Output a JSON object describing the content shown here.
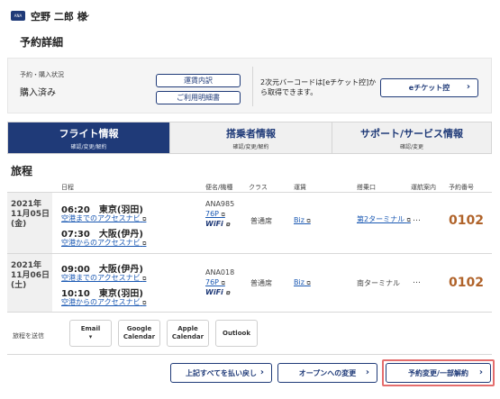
{
  "header": {
    "badge": "ANA",
    "user_name": "空野 二郎 様",
    "chevron": "⌄"
  },
  "page_title": "予約詳細",
  "status": {
    "label": "予約・購入状況",
    "value": "購入済み",
    "receipt_button": "運賃内訳",
    "statement_button": "ご利用明細書",
    "barcode_text": "2次元バーコードは[eチケット控]から取得できます。",
    "eticket_button": "eチケット控",
    "eticket_arrow": "›"
  },
  "tabs": [
    {
      "title": "フライト情報",
      "sub": "確認/変更/解約"
    },
    {
      "title": "搭乗者情報",
      "sub": "確認/変更/解約"
    },
    {
      "title": "サポート/サービス情報",
      "sub": "確認/変更"
    }
  ],
  "itinerary": {
    "title": "旅程",
    "columns": [
      "日程",
      "便名/機種",
      "クラス",
      "運賃",
      "搭乗口",
      "運航案内",
      "予約番号"
    ],
    "flights": [
      {
        "year": "2021年",
        "date": "11月05日",
        "weekday": "(金)",
        "dep_time_place": "06:20　東京(羽田)",
        "dep_access": "空港までのアクセスナビ",
        "arr_time_place": "07:30　大阪(伊丹)",
        "arr_access": "空港からのアクセスナビ",
        "flight_no": "ANA985",
        "aircraft": "76P",
        "wifi": "WiFi",
        "class": "普通席",
        "fare": "Biz",
        "gate": "第2ターミナル",
        "ops": "…",
        "reservation_no": "0102"
      },
      {
        "year": "2021年",
        "date": "11月06日",
        "weekday": "(土)",
        "dep_time_place": "09:00　大阪(伊丹)",
        "dep_access": "空港までのアクセスナビ",
        "arr_time_place": "10:10　東京(羽田)",
        "arr_access": "空港からのアクセスナビ",
        "flight_no": "ANA018",
        "aircraft": "76P",
        "wifi": "WiFi",
        "class": "普通席",
        "fare": "Biz",
        "gate": "南ターミナル",
        "ops": "…",
        "reservation_no": "0102"
      }
    ]
  },
  "share": {
    "label": "旅程を送信",
    "buttons": [
      {
        "line1": "Email",
        "line2": "▾"
      },
      {
        "line1": "Google",
        "line2": "Calendar"
      },
      {
        "line1": "Apple",
        "line2": "Calendar"
      },
      {
        "line1": "Outlook",
        "line2": ""
      }
    ]
  },
  "actions": {
    "refund_all": "上記すべてを払い戻し",
    "change_open": "オープンへの変更",
    "change_partial": "予約変更/一部解約",
    "arrow": "›"
  },
  "icons": {
    "external": "external-link-icon"
  },
  "colors": {
    "brand": "#1f3a78",
    "link": "#1b59b3",
    "reservation": "#b0632a",
    "highlight": "#e46d6d"
  }
}
